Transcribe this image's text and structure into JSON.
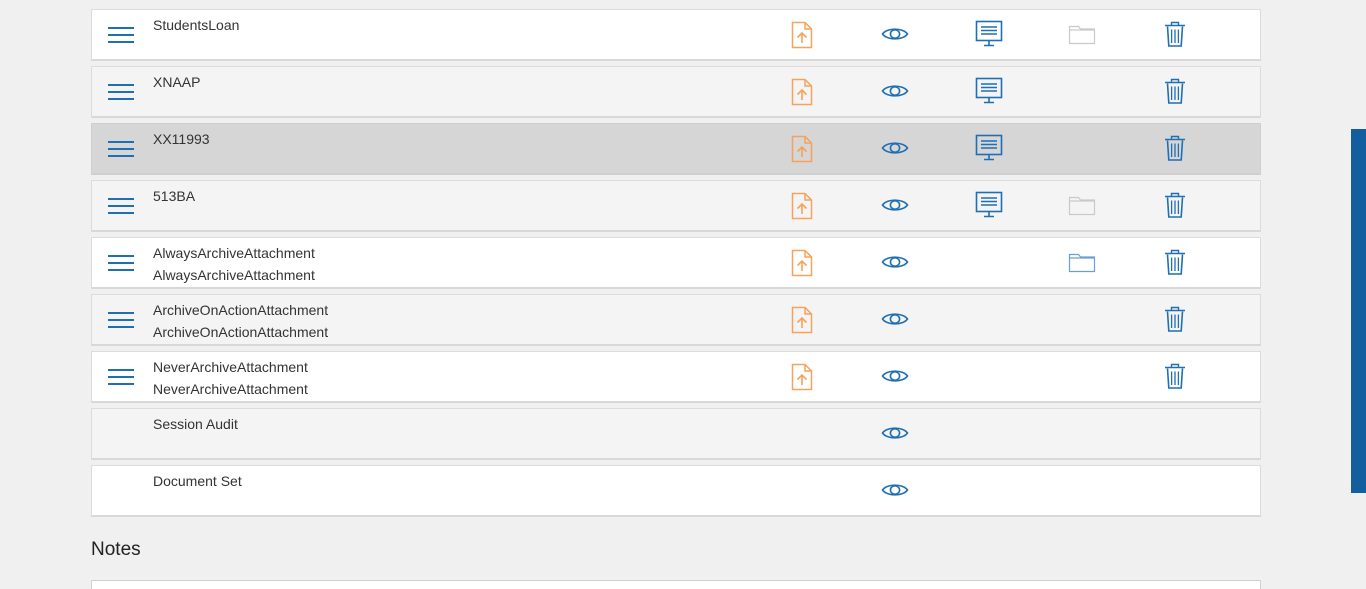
{
  "rows": [
    {
      "name": "StudentsLoan",
      "subname": "",
      "actions": [
        "upload",
        "view",
        "present",
        "folder-empty",
        "delete"
      ],
      "bg": "white",
      "menu": true
    },
    {
      "name": "XNAAP",
      "subname": "",
      "actions": [
        "upload",
        "view",
        "present",
        "delete"
      ],
      "bg": "light",
      "menu": true
    },
    {
      "name": "XX11993",
      "subname": "",
      "actions": [
        "upload",
        "view",
        "present",
        "delete"
      ],
      "bg": "selected",
      "menu": true
    },
    {
      "name": "513BA",
      "subname": "",
      "actions": [
        "upload",
        "view",
        "present",
        "folder-empty",
        "delete"
      ],
      "bg": "light",
      "menu": true
    },
    {
      "name": "AlwaysArchiveAttachment",
      "subname": "AlwaysArchiveAttachment",
      "actions": [
        "upload",
        "view",
        "folder",
        "delete"
      ],
      "bg": "white",
      "menu": true
    },
    {
      "name": "ArchiveOnActionAttachment",
      "subname": "ArchiveOnActionAttachment",
      "actions": [
        "upload",
        "view",
        "delete"
      ],
      "bg": "light",
      "menu": true
    },
    {
      "name": "NeverArchiveAttachment",
      "subname": "NeverArchiveAttachment",
      "actions": [
        "upload",
        "view",
        "delete"
      ],
      "bg": "white",
      "menu": true
    },
    {
      "name": "Session Audit",
      "subname": "",
      "actions": [
        "view"
      ],
      "bg": "light",
      "menu": false
    },
    {
      "name": "Document Set",
      "subname": "",
      "actions": [
        "view"
      ],
      "bg": "white",
      "menu": false
    }
  ],
  "notes": {
    "title": "Notes"
  },
  "colors": {
    "accent_blue": "#1f6fb2",
    "upload_orange": "#f5a25a",
    "folder_gray": "#c9c9c9",
    "folder_blue": "#6a9fcf",
    "scrollbar": "#135e9e"
  }
}
